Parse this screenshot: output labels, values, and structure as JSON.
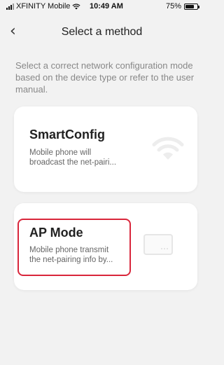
{
  "status_bar": {
    "carrier": "XFINITY Mobile",
    "time": "10:49 AM",
    "battery": "75%",
    "battery_level": 0.75
  },
  "header": {
    "title": "Select a method",
    "back_icon": "chevron-left-icon"
  },
  "description": "Select a correct network configuration mode based on the device type or refer to the user manual.",
  "methods": [
    {
      "title": "SmartConfig",
      "description": "Mobile phone will broadcast the net-pairi...",
      "icon": "wifi-icon"
    },
    {
      "title": "AP Mode",
      "description": "Mobile phone transmit the net-pairing info by...",
      "icon": "router-device-icon",
      "highlighted": true
    }
  ],
  "colors": {
    "background": "#f2f2f2",
    "card": "#ffffff",
    "highlight": "#d9263b"
  }
}
